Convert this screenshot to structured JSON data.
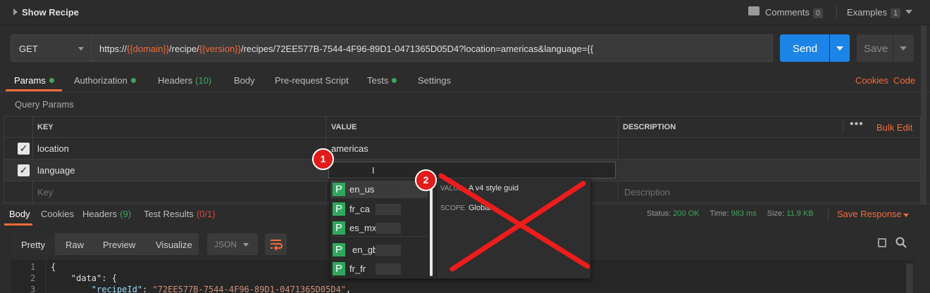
{
  "header": {
    "title": "Show Recipe",
    "comments_label": "Comments",
    "comments_count": "0",
    "examples_label": "Examples",
    "examples_count": "1"
  },
  "request": {
    "method": "GET",
    "url_parts": [
      {
        "text": "https://",
        "var": false
      },
      {
        "text": "{{domain}}",
        "var": true
      },
      {
        "text": "/recipe/",
        "var": false
      },
      {
        "text": "{{version}}",
        "var": true
      },
      {
        "text": "/recipes/72EE577B-7544-4F96-89D1-0471365D05D4?location=americas&language={{",
        "var": false
      }
    ],
    "send_label": "Send",
    "save_label": "Save"
  },
  "request_tabs": [
    {
      "label": "Params",
      "dot": true,
      "active": true
    },
    {
      "label": "Authorization",
      "dot": true
    },
    {
      "label": "Headers",
      "count": "(10)"
    },
    {
      "label": "Body"
    },
    {
      "label": "Pre-request Script"
    },
    {
      "label": "Tests",
      "dot": true
    },
    {
      "label": "Settings"
    }
  ],
  "right_links": {
    "cookies": "Cookies",
    "code": "Code"
  },
  "query_params": {
    "title": "Query Params",
    "columns": {
      "key": "KEY",
      "value": "VALUE",
      "description": "DESCRIPTION"
    },
    "bulk_edit": "Bulk Edit",
    "rows": [
      {
        "key": "location",
        "value": "americas",
        "checked": true
      },
      {
        "key": "language",
        "value": "",
        "checked": true
      }
    ],
    "placeholder_key": "Key",
    "placeholder_description": "Description"
  },
  "annotations": {
    "marker1": "1",
    "marker2": "2"
  },
  "autocomplete": {
    "items": [
      "en_us",
      "fr_ca",
      "es_mx",
      "en_gb",
      "fr_fr"
    ],
    "badge": "P",
    "detail": {
      "value_label": "VALUE",
      "value": "A v4 style guid",
      "scope_label": "SCOPE",
      "scope": "Global"
    }
  },
  "response_tabs": [
    {
      "label": "Body",
      "active": true
    },
    {
      "label": "Cookies"
    },
    {
      "label": "Headers",
      "count": "(9)"
    },
    {
      "label": "Test Results",
      "count": "(0/1)"
    }
  ],
  "response_meta": {
    "status_label": "Status:",
    "status": "200 OK",
    "time_label": "Time:",
    "time": "983 ms",
    "size_label": "Size:",
    "size": "11.9 KB",
    "save_response": "Save Response"
  },
  "view_modes": [
    "Pretty",
    "Raw",
    "Preview",
    "Visualize"
  ],
  "format": "JSON",
  "code_lines": [
    {
      "num": "1",
      "text": "{"
    },
    {
      "num": "2",
      "text": "    \"data\": {"
    },
    {
      "num": "3",
      "key": "        \"recipeId\"",
      "value": "\"72EE577B-7544-4F96-89D1-0471365D05D4\"",
      "tail": ","
    }
  ]
}
